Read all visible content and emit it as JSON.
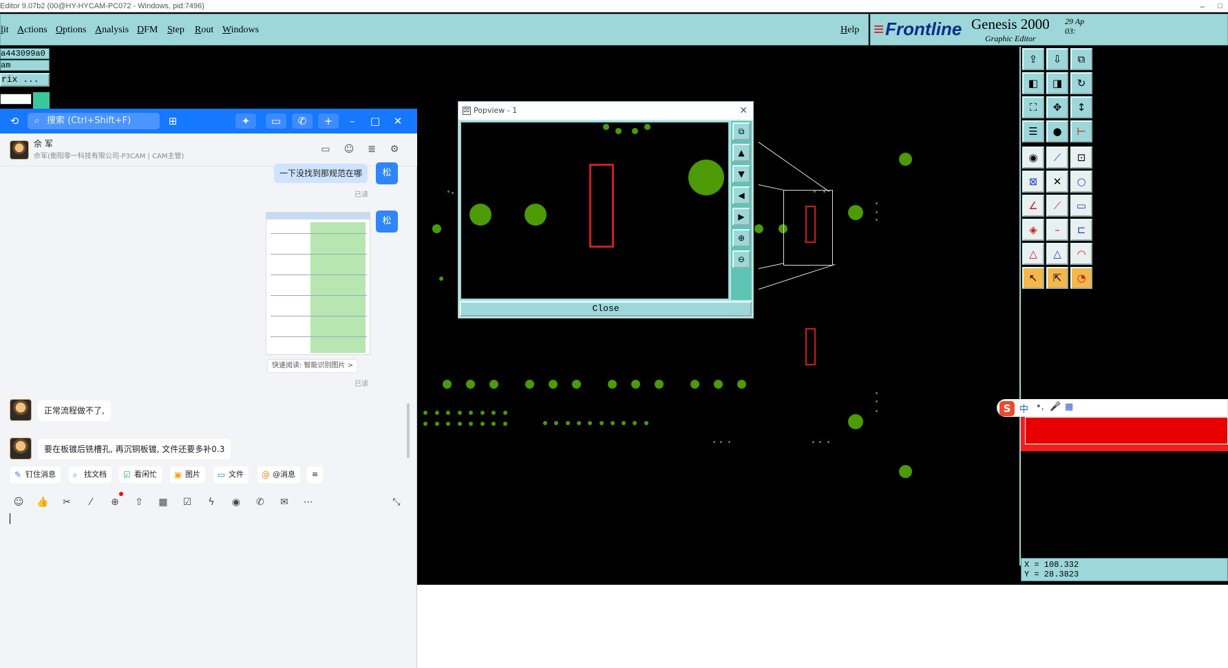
{
  "titlebar": {
    "title": "Editor 9.07b2 (00@HY-HYCAM-PC072 - Windows, pid:7496)",
    "minimize": "–",
    "maximize": "□"
  },
  "menu": {
    "items": [
      "lit",
      "Actions",
      "Options",
      "Analysis",
      "DFM",
      "Step",
      "Rout",
      "Windows"
    ],
    "help": "Help"
  },
  "brand": {
    "logo": "Frontline",
    "product": "Genesis 2000",
    "subtitle": "Graphic Editor",
    "date_top": "29 Ap",
    "date_bottom": "03:"
  },
  "left_info": {
    "job": "a443099a0",
    "step": "am",
    "matrix_btn": "rix ..."
  },
  "chat": {
    "search_placeholder": "搜索 (Ctrl+Shift+F)",
    "contact_name": "佘 军",
    "contact_sub": "佘军(衡阳零一科技有限公司-P3CAM | CAM主管)",
    "my_avatar_label": "松",
    "msg1": "一下没找到那规范在哪",
    "read1": "已读",
    "quick_read": "快速阅读: 智能识别图片 >",
    "read2": "已读",
    "msg2": "正常流程做不了,",
    "msg3": "要在板镀后铣槽孔, 再沉铜板镀, 文件还要多补0.3",
    "tools": [
      {
        "icon": "pin-icon",
        "label": "钉住消息"
      },
      {
        "icon": "find-doc-icon",
        "label": "找文档"
      },
      {
        "icon": "busy-icon",
        "label": "看闲忙"
      },
      {
        "icon": "image-icon",
        "label": "图片"
      },
      {
        "icon": "folder-icon",
        "label": "文件"
      },
      {
        "icon": "mention-icon",
        "label": "@消息"
      }
    ]
  },
  "popview": {
    "title": "Popview - 1",
    "close_label": "Close"
  },
  "coords": {
    "x": "X = 108.332",
    "y": "Y = 28.3823"
  },
  "ime": {
    "items": [
      "中",
      "•,",
      "🎤",
      "▦"
    ]
  },
  "colors": {
    "pad_green": "#4b9a06",
    "slot_red": "#d01c1c",
    "ui_teal": "#9dd7d9",
    "chat_blue": "#1677ff"
  }
}
